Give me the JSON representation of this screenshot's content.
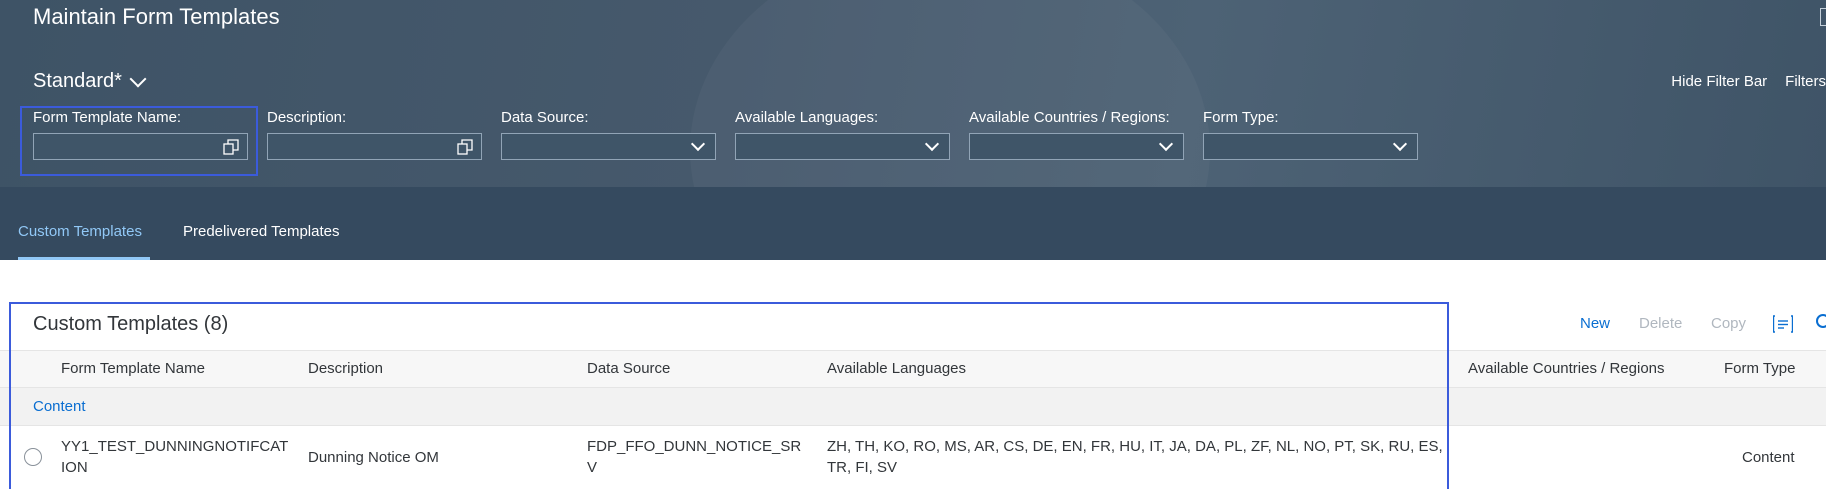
{
  "header": {
    "title": "Maintain Form Templates",
    "variant": "Standard*",
    "hide_filter_bar": "Hide Filter Bar",
    "filters": "Filters"
  },
  "filters": {
    "form_template_name": {
      "label": "Form Template Name:",
      "value": ""
    },
    "description": {
      "label": "Description:",
      "value": ""
    },
    "data_source": {
      "label": "Data Source:",
      "value": ""
    },
    "available_languages": {
      "label": "Available Languages:",
      "value": ""
    },
    "available_countries": {
      "label": "Available Countries / Regions:",
      "value": ""
    },
    "form_type": {
      "label": "Form Type:",
      "value": ""
    }
  },
  "tabs": [
    {
      "label": "Custom Templates",
      "active": true
    },
    {
      "label": "Predelivered Templates",
      "active": false
    }
  ],
  "table": {
    "title": "Custom Templates (8)",
    "toolbar": {
      "new": "New",
      "delete": "Delete",
      "copy": "Copy"
    },
    "columns": [
      "Form Template Name",
      "Description",
      "Data Source",
      "Available Languages",
      "Available Countries / Regions",
      "Form Type"
    ],
    "group": "Content",
    "rows": [
      {
        "name_line1": "YY1_TEST_DUNNINGNOTIFCAT",
        "name_line2": "ION",
        "description": "Dunning Notice OM",
        "source_line1": "FDP_FFO_DUNN_NOTICE_SR",
        "source_line2": "V",
        "lang_line1": "ZH, TH, KO, RO, MS, AR, CS, DE, EN, FR, HU, IT, JA, DA, PL, ZF, NL, NO, PT, SK, RU, ES,",
        "lang_line2": "TR, FI, SV",
        "countries": "",
        "form_type": "Content"
      }
    ]
  },
  "colors": {
    "header_bg": "#46596c",
    "tabbar_bg": "#354a5f",
    "accent": "#0a6ed1",
    "tab_active": "#91c8f6",
    "highlight_frame": "#3b5bdb"
  },
  "icons": {
    "value_help": "value-help-icon",
    "dropdown": "chevron-down-icon",
    "settings": "settings-icon",
    "sort": "sort-icon"
  }
}
